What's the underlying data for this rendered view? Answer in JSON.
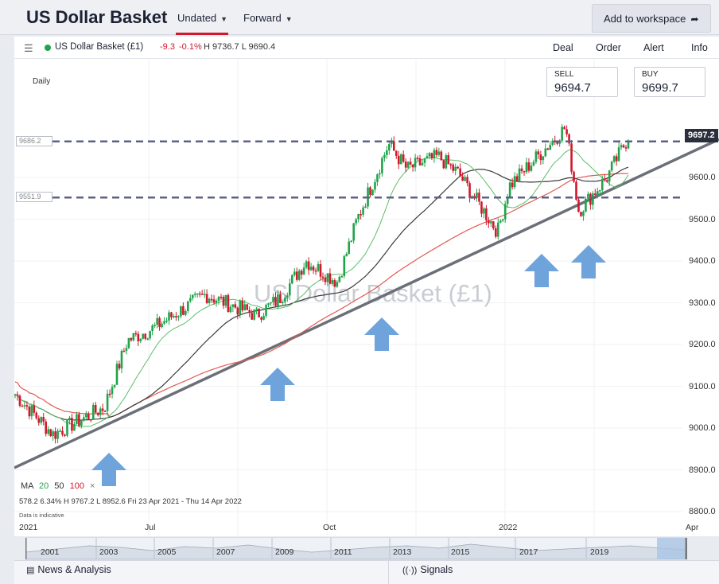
{
  "header": {
    "title": "US Dollar Basket",
    "tab_undated": "Undated",
    "tab_forward": "Forward",
    "add_workspace": "Add to workspace"
  },
  "instrument": {
    "name": "US Dollar Basket (£1)",
    "change": "-9.3",
    "change_pct": "-0.1%",
    "high_low": "H 9736.7  L 9690.4"
  },
  "actions": {
    "deal": "Deal",
    "order": "Order",
    "alert": "Alert",
    "info": "Info"
  },
  "chart": {
    "period": "Daily",
    "sell_label": "SELL",
    "sell_value": "9694.7",
    "buy_label": "BUY",
    "buy_value": "9699.7",
    "current_price": "9697.2",
    "hline1": "9686.2",
    "hline2": "9551.9",
    "watermark": "US Dollar Basket (£1)",
    "y_ticks": [
      "9600.0",
      "9500.0",
      "9400.0",
      "9300.0",
      "9200.0",
      "9100.0",
      "9000.0",
      "8900.0",
      "8800.0"
    ],
    "x_ticks": [
      "2021",
      "Jul",
      "Oct",
      "2022",
      "Apr"
    ],
    "ma_legend": {
      "prefix": "MA",
      "p1": "20",
      "p2": "50",
      "p3": "100",
      "close": "×"
    },
    "stats": "578.2    6.34%    H 9767.2   L 8952.6   Fri 23 Apr 2021 - Thu 14 Apr 2022",
    "indicative": "Data is indicative",
    "colors": {
      "up": "#21a34b",
      "down": "#d0192c",
      "ma20": "#5bbf66",
      "ma50": "#3a3a3a",
      "ma100": "#e05b50",
      "trendline": "#6b6f78",
      "arrow": "#6fa3db"
    }
  },
  "chart_data": {
    "type": "candlestick",
    "title": "US Dollar Basket (£1)",
    "period": "Daily",
    "x_range": [
      "2021-04",
      "2022-04"
    ],
    "ylim": [
      8800,
      9760
    ],
    "close_approx": [
      {
        "x": "2021-04",
        "y": 9110
      },
      {
        "x": "2021-05",
        "y": 8985
      },
      {
        "x": "2021-06",
        "y": 9050
      },
      {
        "x": "2021-06-15",
        "y": 9210
      },
      {
        "x": "2021-07",
        "y": 9240
      },
      {
        "x": "2021-08",
        "y": 9320
      },
      {
        "x": "2021-09",
        "y": 9270
      },
      {
        "x": "2021-09-15",
        "y": 9310
      },
      {
        "x": "2021-10",
        "y": 9400
      },
      {
        "x": "2021-10-20",
        "y": 9350
      },
      {
        "x": "2021-11",
        "y": 9500
      },
      {
        "x": "2021-11-20",
        "y": 9680
      },
      {
        "x": "2021-12",
        "y": 9620
      },
      {
        "x": "2021-12-20",
        "y": 9650
      },
      {
        "x": "2022-01",
        "y": 9610
      },
      {
        "x": "2022-01-25",
        "y": 9470
      },
      {
        "x": "2022-02",
        "y": 9580
      },
      {
        "x": "2022-03-07",
        "y": 9720
      },
      {
        "x": "2022-03-15",
        "y": 9520
      },
      {
        "x": "2022-04",
        "y": 9600
      },
      {
        "x": "2022-04-14",
        "y": 9697
      }
    ],
    "horizontal_levels": [
      9686.2,
      9551.9
    ],
    "moving_averages": [
      "MA 20",
      "MA 50",
      "MA 100"
    ],
    "high": 9767.2,
    "low": 8952.6
  },
  "navigator": {
    "years": [
      "2001",
      "2003",
      "2005",
      "2007",
      "2009",
      "2011",
      "2013",
      "2015",
      "2017",
      "2019"
    ]
  },
  "footer": {
    "news": "News & Analysis",
    "signals": "Signals"
  }
}
